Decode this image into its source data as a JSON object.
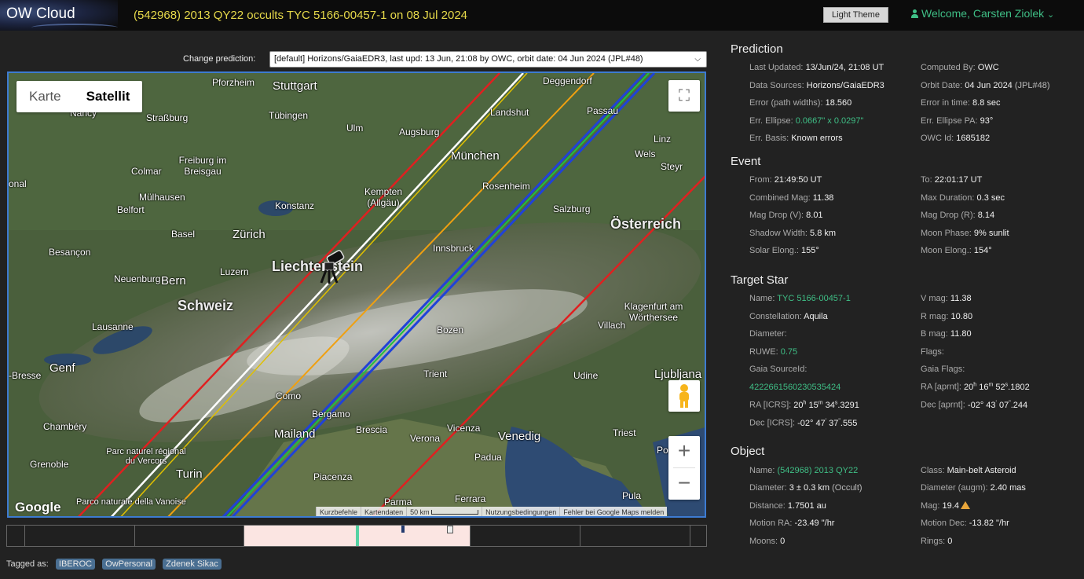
{
  "header": {
    "app_name": "OW Cloud",
    "event_title": "(542968) 2013 QY22 occults TYC 5166-00457-1 on 08 Jul 2024",
    "theme_button": "Light Theme",
    "welcome": "Welcome, Carsten Ziolek"
  },
  "prediction_select": {
    "label": "Change prediction:",
    "value": "[default] Horizons/GaiaEDR3, last upd: 13 Jun, 21:08 by OWC, orbit date: 04 Jun 2024 (JPL#48)"
  },
  "map": {
    "type_buttons": [
      "Karte",
      "Satellit"
    ],
    "active_type": "Satellit",
    "google": "Google",
    "attribution": [
      "Kurzbefehle",
      "Kartendaten",
      "50 km",
      "Nutzungsbedingungen",
      "Fehler bei Google Maps melden"
    ],
    "places": [
      "Pforzheim",
      "Stuttgart",
      "Deggendorf",
      "Nancy",
      "Straßburg",
      "Tübingen",
      "Ulm",
      "Augsburg",
      "Landshut",
      "Passau",
      "Freiburg im Breisgau",
      "Colmar",
      "München",
      "Linz",
      "Wels",
      "Steyr",
      "Kempten (Allgäu)",
      "Rosenheim",
      "Mülhausen",
      "Belfort",
      "Konstanz",
      "Salzburg",
      "Österreich",
      "Basel",
      "Zürich",
      "Besançon",
      "Liechtenstein",
      "Innsbruck",
      "Neuenburg",
      "Bern",
      "Luzern",
      "Schweiz",
      "Klagenfurt am Wörthersee",
      "Villach",
      "Lausanne",
      "Bozen",
      "Genf",
      "Trient",
      "Udine",
      "Ljubljana",
      "Chambéry",
      "Como",
      "Bergamo",
      "Brescia",
      "Vicenza",
      "Mailand",
      "Verona",
      "Venedig",
      "Triest",
      "Padua",
      "Grenoble",
      "Parc naturel régional du Vercors",
      "Turin",
      "Piacenza",
      "Parma",
      "Ferrara",
      "Pula",
      "onal",
      "-Bresse",
      "Parco naturale della Vanoise",
      "Poz"
    ]
  },
  "tagged_as": {
    "label": "Tagged as:",
    "tags": [
      "IBEROC",
      "OwPersonal",
      "Zdenek Sikac"
    ]
  },
  "panel": {
    "prediction": {
      "title": "Prediction",
      "last_updated_label": "Last Updated:",
      "last_updated": "13/Jun/24, 21:08 UT",
      "computed_by_label": "Computed By:",
      "computed_by": "OWC",
      "data_sources_label": "Data Sources:",
      "data_sources": "Horizons/GaiaEDR3",
      "orbit_date_label": "Orbit Date:",
      "orbit_date": "04 Jun 2024",
      "orbit_jpl": "(JPL#48)",
      "error_path_label": "Error (path widths):",
      "error_path": "18.560",
      "error_time_label": "Error in time:",
      "error_time": "8.8 sec",
      "err_ellipse_label": "Err. Ellipse:",
      "err_ellipse": "0.0667\" x 0.0297\"",
      "err_ellipse_pa_label": "Err. Ellipse PA:",
      "err_ellipse_pa": "93°",
      "err_basis_label": "Err. Basis:",
      "err_basis": "Known errors",
      "owc_id_label": "OWC Id:",
      "owc_id": "1685182"
    },
    "event": {
      "title": "Event",
      "from_label": "From:",
      "from": "21:49:50 UT",
      "to_label": "To:",
      "to": "22:01:17 UT",
      "combined_mag_label": "Combined Mag:",
      "combined_mag": "11.38",
      "max_duration_label": "Max Duration:",
      "max_duration": "0.3 sec",
      "mag_drop_v_label": "Mag Drop (V):",
      "mag_drop_v": "8.01",
      "mag_drop_r_label": "Mag Drop (R):",
      "mag_drop_r": "8.14",
      "shadow_width_label": "Shadow Width:",
      "shadow_width": "5.8 km",
      "moon_phase_label": "Moon Phase:",
      "moon_phase": "9% sunlit",
      "solar_elong_label": "Solar Elong.:",
      "solar_elong": "155°",
      "moon_elong_label": "Moon Elong.:",
      "moon_elong": "154°"
    },
    "target_star": {
      "title": "Target Star",
      "name_label": "Name:",
      "name": "TYC 5166-00457-1",
      "vmag_label": "V mag:",
      "vmag": "11.38",
      "constellation_label": "Constellation:",
      "constellation": "Aquila",
      "rmag_label": "R mag:",
      "rmag": "10.80",
      "diameter_label": "Diameter:",
      "bmag_label": "B mag:",
      "bmag": "11.80",
      "ruwe_label": "RUWE:",
      "ruwe": "0.75",
      "flags_label": "Flags:",
      "gaia_source_label": "Gaia SourceId:",
      "gaia_source": "4222661560230535424",
      "gaia_flags_label": "Gaia Flags:",
      "ra_aprnt_label": "RA [aprnt]:",
      "ra_aprnt_h": "20",
      "ra_aprnt_m": "16",
      "ra_aprnt_s": "52",
      "ra_aprnt_frac": ".1802",
      "ra_icrs_label": "RA [ICRS]:",
      "ra_icrs_h": "20",
      "ra_icrs_m": "15",
      "ra_icrs_s": "34",
      "ra_icrs_frac": ".3291",
      "dec_aprnt_label": "Dec [aprnt]:",
      "dec_aprnt_d": "-02°",
      "dec_aprnt_m": "43",
      "dec_aprnt_s": "07",
      "dec_aprnt_frac": ".244",
      "dec_icrs_label": "Dec [ICRS]:",
      "dec_icrs_d": "-02°",
      "dec_icrs_m": "47",
      "dec_icrs_s": "37",
      "dec_icrs_frac": ".555"
    },
    "object": {
      "title": "Object",
      "name_label": "Name:",
      "name": "(542968) 2013 QY22",
      "class_label": "Class:",
      "class": "Main-belt Asteroid",
      "diameter_label": "Diameter:",
      "diameter": "3 ± 0.3 km",
      "diameter_src": "(Occult)",
      "diameter_augm_label": "Diameter (augm):",
      "diameter_augm": "2.40 mas",
      "distance_label": "Distance:",
      "distance": "1.7501 au",
      "mag_label": "Mag:",
      "mag": "19.4",
      "motion_ra_label": "Motion RA:",
      "motion_ra": "-23.49 \"/hr",
      "motion_dec_label": "Motion Dec:",
      "motion_dec": "-13.82 \"/hr",
      "moons_label": "Moons:",
      "moons": "0",
      "rings_label": "Rings:",
      "rings": "0"
    }
  }
}
